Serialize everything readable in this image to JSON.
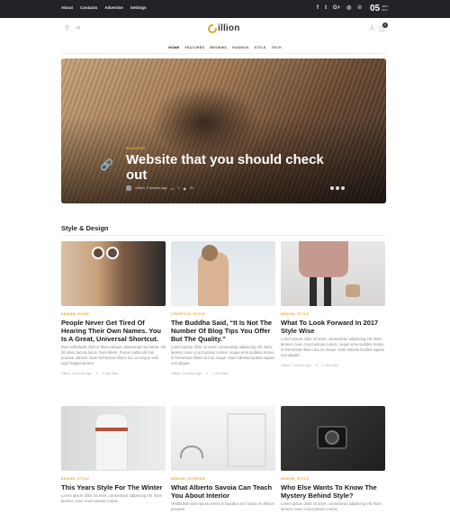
{
  "topbar": {
    "nav": [
      "About",
      "Contacts",
      "Advertise",
      "Settings"
    ],
    "social_icons": [
      "facebook-icon",
      "twitter-icon",
      "google-plus-icon",
      "instagram-icon",
      "pinterest-icon"
    ],
    "social_glyphs": [
      "f",
      "t",
      "G+",
      "◎",
      "℗"
    ],
    "date_day": "05",
    "date_month": "SEPT 2017"
  },
  "header": {
    "logo_text": "illion",
    "cart_count": "0"
  },
  "mainnav": {
    "items": [
      "HOME",
      "FEATURES",
      "REVIEWS",
      "FASHION",
      "STYLE",
      "TECH"
    ]
  },
  "hero": {
    "category": "BUSINESS",
    "title": "Website that you should check out",
    "meta_author_date": "Gillion, 3 months ago",
    "meta_comments": "1",
    "meta_views": "31",
    "slides": 3
  },
  "section": {
    "title": "Style & Design"
  },
  "cards": [
    {
      "category": "DESIGN, GUIDE",
      "title": "People Never Get Tired Of Hearing Their Own Names. You Is A Great, Universal Shortcut.",
      "excerpt": "Duis sollicitudin nibh et libero aliquet, Maecenas nisi lorem, elit sit amet, lacinia lacus. Nam libero. Fusce mattis elit non pulvinar ultrices. Nam fermentum libero dui, a congue velit eget feugiat laoreet.",
      "meta_date": "Gillion, 3 months ago",
      "meta_comments": "0",
      "meta_read": "1 min read"
    },
    {
      "category": "LIFESTYLE, STYLE",
      "title": "The Buddha Said, “It Is Not The Number Of Blog Tips You Offer But The Quality.”",
      "excerpt": "Lorem ipsum dolor sit amet, consectetur adipiscing elit. Nam laoreet, nunc et accumsan cursus, neque eros sodales lectus, in fermentum libero dui eu neque. Nam lobortis facilisis sapien non aliquet.",
      "meta_date": "Gillion, 3 months ago",
      "meta_comments": "0",
      "meta_read": "1 min read"
    },
    {
      "category": "DESIGN, STYLE",
      "title": "What To Look Forward In 2017 Style Wise",
      "excerpt": "Lorem ipsum dolor sit amet, consectetur adipiscing elit. Nam laoreet, nunc et accumsan cursus, neque eros sodales lectus, in fermentum libero dui eu neque. Nam lobortis facilisis sapien non aliquet.",
      "meta_date": "Gillion, 3 months ago",
      "meta_comments": "0",
      "meta_read": "1 min read"
    },
    {
      "category": "DESIGN, STYLE",
      "title": "This Years Style For The Winter",
      "excerpt": "Lorem ipsum dolor sit amet, consectetur adipiscing elit. Nam laoreet, nunc et accumsan cursus,"
    },
    {
      "category": "DESIGN, INTERIOR",
      "title": "What Alberto Savoia Can Teach You About Interior",
      "excerpt": "Vestibulum ante ipsum primis in faucibus orci luctus et ultrices posuere"
    },
    {
      "category": "DESIGN, STYLE",
      "title": "Who Else Wants To Know The Mystery Behind Style?",
      "excerpt": "Lorem ipsum dolor sit amet, consectetur adipiscing elit. Nam laoreet, nunc et accumsan cursus,"
    }
  ]
}
